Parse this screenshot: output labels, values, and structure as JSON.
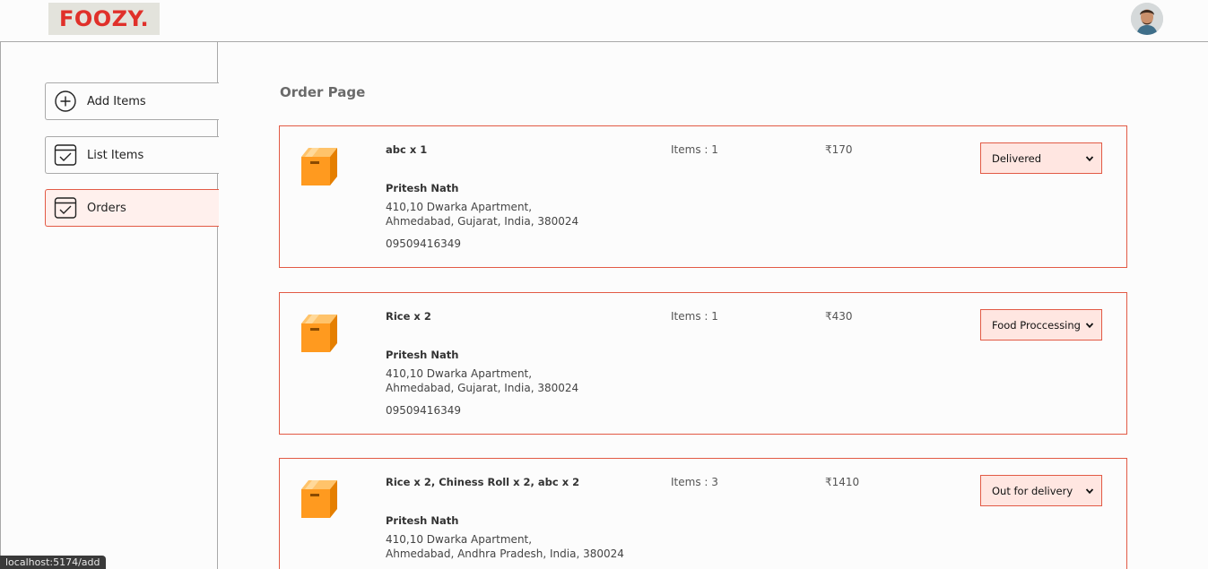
{
  "header": {
    "logo_text": "FOOZY."
  },
  "sidebar": {
    "items": [
      {
        "label": "Add Items",
        "icon": "plus-circle-icon"
      },
      {
        "label": "List Items",
        "icon": "checklist-icon"
      },
      {
        "label": "Orders",
        "icon": "checklist-icon",
        "active": true
      }
    ]
  },
  "main": {
    "title": "Order Page",
    "orders": [
      {
        "items": "abc x 1",
        "customer": "Pritesh Nath",
        "address_line1": "410,10 Dwarka Apartment,",
        "address_line2": "Ahmedabad, Gujarat, India, 380024",
        "phone": "09509416349",
        "count": "Items : 1",
        "amount": "₹170",
        "status": "Delivered"
      },
      {
        "items": "Rice x 2",
        "customer": "Pritesh Nath",
        "address_line1": "410,10 Dwarka Apartment,",
        "address_line2": "Ahmedabad, Gujarat, India, 380024",
        "phone": "09509416349",
        "count": "Items : 1",
        "amount": "₹430",
        "status": "Food Proccessing"
      },
      {
        "items": "Rice x 2, Chiness Roll x 2, abc x 2",
        "customer": "Pritesh Nath",
        "address_line1": "410,10 Dwarka Apartment,",
        "address_line2": "Ahmedabad, Andhra Pradesh, India, 380024",
        "phone": "",
        "count": "Items : 3",
        "amount": "₹1410",
        "status": "Out for delivery"
      }
    ]
  },
  "status_bar": {
    "url": "localhost:5174/add"
  },
  "colors": {
    "accent": "#e25a45",
    "active_bg": "#fff0ed",
    "select_bg": "#ffe6e1",
    "logo_red": "#e0302a",
    "parcel_orange": "#ff9a1f"
  }
}
